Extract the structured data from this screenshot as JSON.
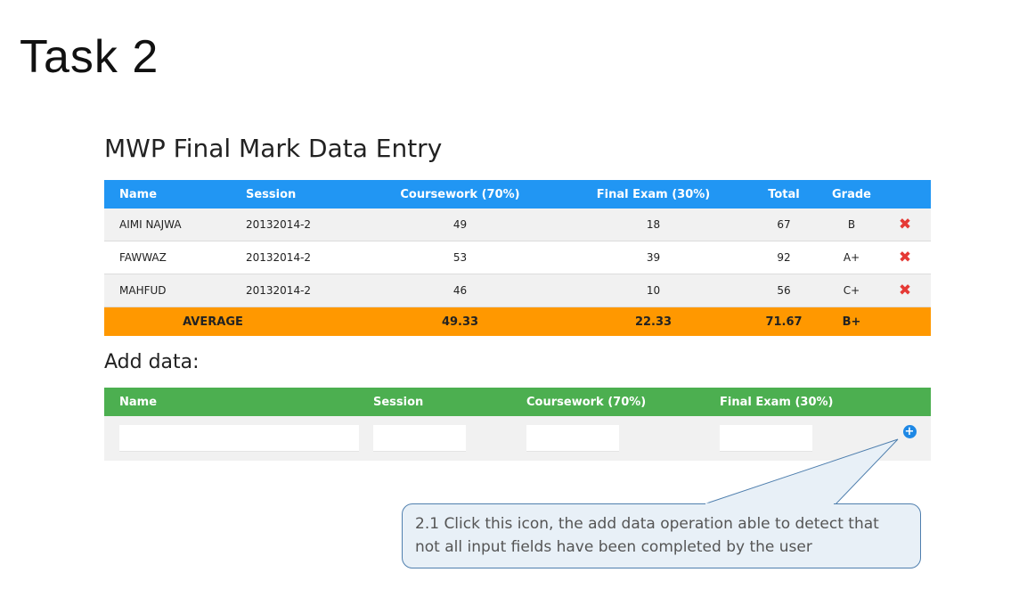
{
  "slide": {
    "title": "Task 2"
  },
  "app": {
    "title": "MWP Final Mark Data Entry"
  },
  "table": {
    "headers": {
      "name": "Name",
      "session": "Session",
      "coursework": "Coursework (70%)",
      "final": "Final Exam (30%)",
      "total": "Total",
      "grade": "Grade"
    },
    "rows": [
      {
        "name": "AIMI NAJWA",
        "session": "20132014-2",
        "coursework": "49",
        "final": "18",
        "total": "67",
        "grade": "B",
        "delete_icon": "x-delete-icon"
      },
      {
        "name": "FAWWAZ",
        "session": "20132014-2",
        "coursework": "53",
        "final": "39",
        "total": "92",
        "grade": "A+",
        "delete_icon": "x-delete-icon"
      },
      {
        "name": "MAHFUD",
        "session": "20132014-2",
        "coursework": "46",
        "final": "10",
        "total": "56",
        "grade": "C+",
        "delete_icon": "x-delete-icon"
      }
    ],
    "average": {
      "label": "AVERAGE",
      "coursework": "49.33",
      "final": "22.33",
      "total": "71.67",
      "grade": "B+"
    }
  },
  "add_form": {
    "title": "Add data:",
    "headers": {
      "name": "Name",
      "session": "Session",
      "coursework": "Coursework (70%)",
      "final": "Final Exam (30%)"
    },
    "values": {
      "name": "",
      "session": "",
      "coursework": "",
      "final": ""
    },
    "add_icon": "plus-circle-icon"
  },
  "callout": {
    "line1": "2.1 Click this icon, the add data operation able to detect that",
    "line2": "not all input fields have been completed by the user"
  },
  "colors": {
    "header_blue": "#2196f3",
    "average_orange": "#ff9800",
    "add_header_green": "#4caf50",
    "delete_red": "#e53935",
    "add_icon_blue": "#1e88e5"
  }
}
